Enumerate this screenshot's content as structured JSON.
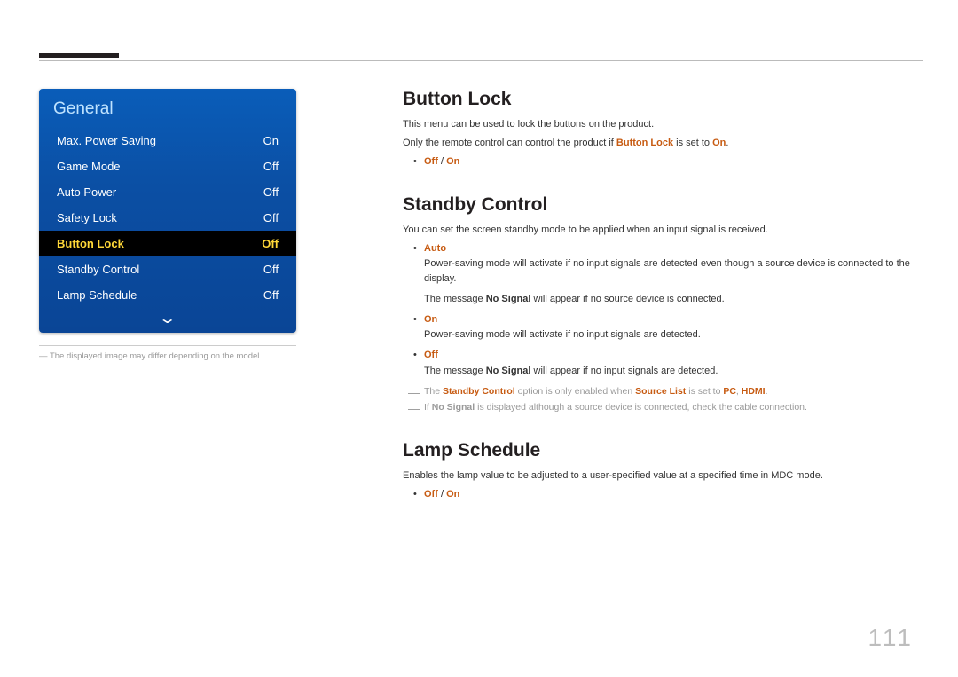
{
  "page_number": "111",
  "menu": {
    "title": "General",
    "items": [
      {
        "label": "Max. Power Saving",
        "value": "On",
        "selected": false
      },
      {
        "label": "Game Mode",
        "value": "Off",
        "selected": false
      },
      {
        "label": "Auto Power",
        "value": "Off",
        "selected": false
      },
      {
        "label": "Safety Lock",
        "value": "Off",
        "selected": false
      },
      {
        "label": "Button Lock",
        "value": "Off",
        "selected": true
      },
      {
        "label": "Standby Control",
        "value": "Off",
        "selected": false
      },
      {
        "label": "Lamp Schedule",
        "value": "Off",
        "selected": false
      }
    ],
    "footnote_prefix_dash": "―",
    "footnote": "The displayed image may differ depending on the model."
  },
  "sections": {
    "button_lock": {
      "title": "Button Lock",
      "p1": "This menu can be used to lock the buttons on the product.",
      "p2_a": "Only the remote control can control the product if ",
      "p2_hl": "Button Lock",
      "p2_b": " is set to ",
      "p2_hl2": "On",
      "p2_c": ".",
      "opt_off": "Off",
      "opt_sep": " / ",
      "opt_on": "On"
    },
    "standby": {
      "title": "Standby Control",
      "p1": "You can set the screen standby mode to be applied when an input signal is received.",
      "auto_label": "Auto",
      "auto_desc": "Power-saving mode will activate if no input signals are detected even though a source device is connected to the display.",
      "auto_note_a": "The message ",
      "auto_note_hl": "No Signal",
      "auto_note_b": " will appear if no source device is connected.",
      "on_label": "On",
      "on_desc": "Power-saving mode will activate if no input signals are detected.",
      "off_label": "Off",
      "off_note_a": "The message ",
      "off_note_hl": "No Signal",
      "off_note_b": " will appear if no input signals are detected.",
      "note1_a": "The ",
      "note1_hl1": "Standby Control",
      "note1_b": " option is only enabled when ",
      "note1_hl2": "Source List",
      "note1_c": " is set to ",
      "note1_hl3": "PC",
      "note1_comma": ", ",
      "note1_hl4": "HDMI",
      "note1_d": ".",
      "note2_a": "If ",
      "note2_hl": "No Signal",
      "note2_b": " is displayed although a source device is connected, check the cable connection."
    },
    "lamp": {
      "title": "Lamp Schedule",
      "p1": "Enables the lamp value to be adjusted to a user-specified value at a specified time in MDC mode.",
      "opt_off": "Off",
      "opt_sep": " / ",
      "opt_on": "On"
    }
  }
}
